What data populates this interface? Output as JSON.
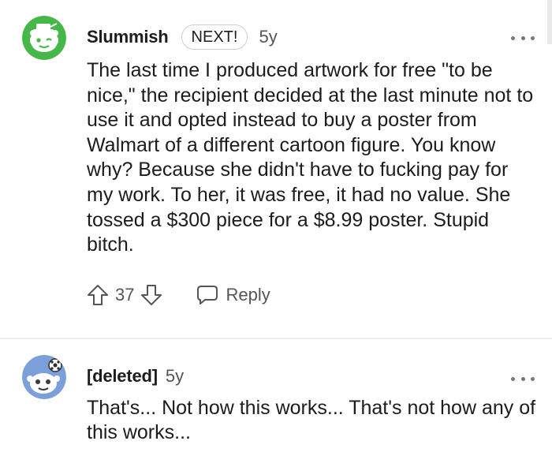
{
  "comments": [
    {
      "username": "Slummish",
      "flair": "NEXT!",
      "age": "5y",
      "avatar_icon": "snoo-avatar-icon",
      "avatar_color": "#46b84a",
      "body": "The last time I produced artwork for free \"to be nice,\" the recipient decided at the last minute not to use it and opted instead to buy a poster from Walmart of a different cartoon figure. You know why? Because she didn't have to fucking pay for my work. To her, it was free, it had no value. She tossed a $300 piece for a $8.99 poster. Stupid bitch.",
      "score": "37",
      "reply_label": "Reply"
    },
    {
      "username": "[deleted]",
      "age": "5y",
      "avatar_icon": "snoo-avatar-icon",
      "avatar_color": "#7b9fd8",
      "body": "That's... Not how this works... That's not how any of this works..."
    }
  ],
  "icons": {
    "upvote": "arrow-up-icon",
    "downvote": "arrow-down-icon",
    "reply": "speech-bubble-icon",
    "more": "more-options-icon"
  }
}
